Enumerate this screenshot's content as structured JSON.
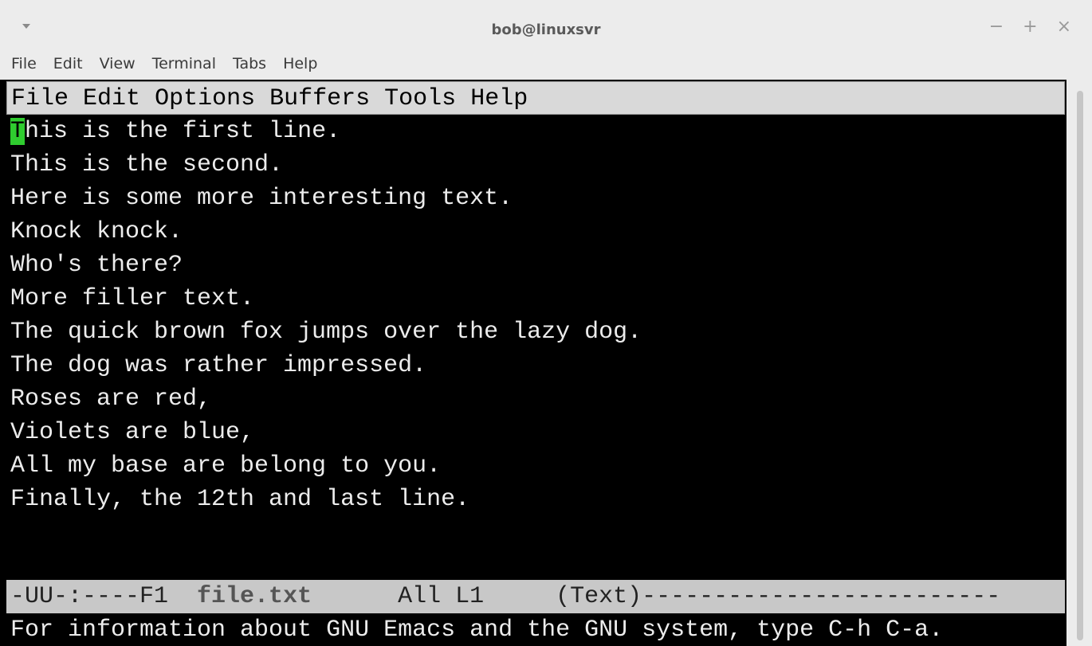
{
  "window": {
    "title": "bob@linuxsvr",
    "controls": {
      "minimize": "−",
      "maximize": "+",
      "close": "×"
    }
  },
  "terminal_menu": [
    "File",
    "Edit",
    "View",
    "Terminal",
    "Tabs",
    "Help"
  ],
  "emacs": {
    "menu": [
      "File",
      "Edit",
      "Options",
      "Buffers",
      "Tools",
      "Help"
    ],
    "cursor_char": "T",
    "buffer_lines": [
      "This is the first line.",
      "This is the second.",
      "Here is some more interesting text.",
      "Knock knock.",
      "Who's there?",
      "More filler text.",
      "The quick brown fox jumps over the lazy dog.",
      "The dog was rather impressed.",
      "Roses are red,",
      "Violets are blue,",
      "All my base are belong to you.",
      "Finally, the 12th and last line."
    ],
    "modeline": {
      "prefix": "-UU-:----F1  ",
      "filename": "file.txt",
      "middle": "      All L1     (Text)",
      "tail": "-------------------------"
    },
    "echo": "For information about GNU Emacs and the GNU system, type C-h C-a."
  },
  "colors": {
    "cursor": "#2fcc2f",
    "chrome": "#ececec",
    "modeline_bg": "#c8c8c8"
  }
}
